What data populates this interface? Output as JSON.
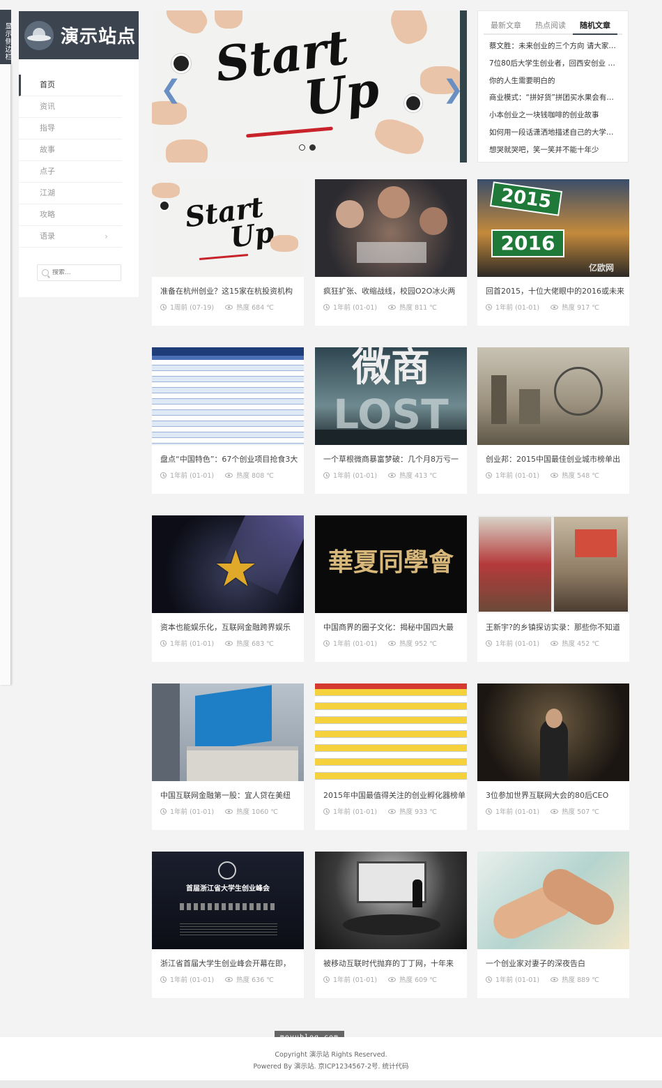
{
  "side_toggle": {
    "label": "显示侧边栏"
  },
  "logo": {
    "text": "演示站点"
  },
  "nav": {
    "items": [
      {
        "label": "首页",
        "active": true
      },
      {
        "label": "资讯"
      },
      {
        "label": "指导"
      },
      {
        "label": "故事"
      },
      {
        "label": "点子"
      },
      {
        "label": "江湖"
      },
      {
        "label": "攻略"
      },
      {
        "label": "语录",
        "has_submenu": true
      }
    ]
  },
  "search": {
    "placeholder": "搜索..."
  },
  "slider": {
    "text_line1": "Start",
    "text_line2": "Up"
  },
  "widget": {
    "tabs": [
      "最新文章",
      "热点阅读",
      "随机文章"
    ],
    "active_tab": 2,
    "items": [
      "蔡文胜：未来创业的三个方向 请大家…",
      "7位80后大学生创业者，回西安创业 …",
      "你的人生需要明白的",
      "商业模式：“拼好货”拼团买水果会有…",
      "小本创业之一块钱咖啡的创业故事",
      "如何用一段话潇洒地描述自己的大学…",
      "想哭就哭吧，笑一笑并不能十年少"
    ]
  },
  "cards": [
    {
      "title": "准备在杭州创业？这15家在杭投资机构",
      "time": "1周前 (07-19)",
      "heat": "热度 684 ℃",
      "thumb": "startup"
    },
    {
      "title": "疯狂扩张、收缩战线，校园O2O冰火两",
      "time": "1年前 (01-01)",
      "heat": "热度 811 ℃",
      "thumb": "party"
    },
    {
      "title": "回首2015，十位大佬眼中的2016或未来",
      "time": "1年前 (01-01)",
      "heat": "热度 917 ℃",
      "thumb": "road",
      "thumb_text1": "2015",
      "thumb_text2": "2016",
      "thumb_brand": "亿欧网"
    },
    {
      "title": "盘点“中国特色”：67个创业项目抢食3大",
      "time": "1年前 (01-01)",
      "heat": "热度 808 ℃",
      "thumb": "table"
    },
    {
      "title": "一个草根微商暴富梦破：几个月8万亏一",
      "time": "1年前 (01-01)",
      "heat": "热度 413 ℃",
      "thumb": "weishang",
      "thumb_text1": "微商",
      "thumb_text2": "LOST"
    },
    {
      "title": "创业邦：2015中国最佳创业城市榜单出",
      "time": "1年前 (01-01)",
      "heat": "热度 548 ℃",
      "thumb": "city"
    },
    {
      "title": "资本也能娱乐化，互联网金融跨界娱乐",
      "time": "1年前 (01-01)",
      "heat": "热度 683 ℃",
      "thumb": "star"
    },
    {
      "title": "中国商界的圈子文化：揭秘中国四大最",
      "time": "1年前 (01-01)",
      "heat": "热度 952 ℃",
      "thumb": "huaxia",
      "thumb_text1": "華夏同學會"
    },
    {
      "title": "王新宇?的乡镇探访实录：那些你不知道",
      "time": "1年前 (01-01)",
      "heat": "热度 452 ℃",
      "thumb": "village"
    },
    {
      "title": "中国互联网金融第一股：宜人贷在美纽",
      "time": "1年前 (01-01)",
      "heat": "热度 1060 ℃",
      "thumb": "nyse"
    },
    {
      "title": "2015年中国最值得关注的创业孵化器榜单",
      "time": "1年前 (01-01)",
      "heat": "热度 933 ℃",
      "thumb": "yellowtable"
    },
    {
      "title": "3位参加世界互联网大会的80后CEO",
      "time": "1年前 (01-01)",
      "heat": "热度 507 ℃",
      "thumb": "hall"
    },
    {
      "title": "浙江省首届大学生创业峰会开幕在即，",
      "time": "1年前 (01-01)",
      "heat": "热度 636 ℃",
      "thumb": "summit",
      "thumb_text1": "首届浙江省大学生创业峰会"
    },
    {
      "title": "被移动互联时代抛弃的丁丁网，十年来",
      "time": "1年前 (01-01)",
      "heat": "热度 609 ℃",
      "thumb": "room"
    },
    {
      "title": "一个创业家对妻子的深夜告白",
      "time": "1年前 (01-01)",
      "heat": "热度 889 ℃",
      "thumb": "hands"
    }
  ],
  "footer": {
    "watermark": "moyublog.com",
    "line1": "Copyright 演示站 Rights Reserved.",
    "line2": "Powered By 演示站. 京ICP1234567-2号. 统计代码"
  }
}
